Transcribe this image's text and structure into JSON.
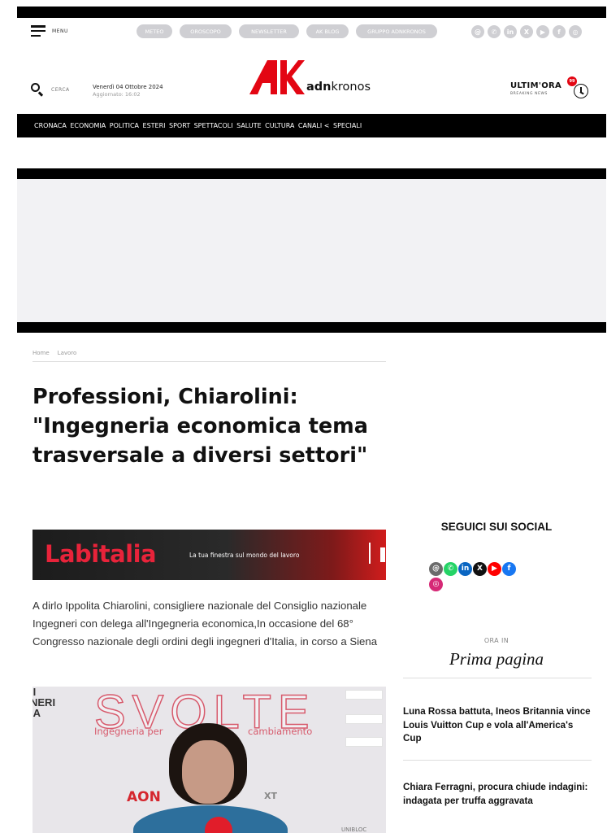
{
  "header": {
    "menu_label": "MENU",
    "search_label": "CERCA",
    "date": "Venerdì 04 Ottobre 2024",
    "updated": "Aggiornato: 16:02",
    "logo_text_bold": "adn",
    "logo_text_regular": "kronos",
    "breaking_title": "ULTIM'ORA",
    "breaking_sub": "BREAKING NEWS",
    "breaking_badge": "99",
    "brand_color": "#e30613"
  },
  "util_pills": [
    "METEO",
    "OROSCOPO",
    "NEWSLETTER",
    "AK BLOG",
    "GRUPPO ADNKRONOS"
  ],
  "top_social_icons": [
    "threads-icon",
    "whatsapp-icon",
    "linkedin-icon",
    "x-icon",
    "youtube-icon",
    "facebook-icon",
    "instagram-icon"
  ],
  "nav": [
    "CRONACA",
    "ECONOMIA",
    "POLITICA",
    "ESTERI",
    "SPORT",
    "SPETTACOLI",
    "SALUTE",
    "CULTURA",
    "CANALI <",
    "SPECIALI"
  ],
  "breadcrumb": [
    "Home",
    "Lavoro"
  ],
  "article": {
    "title": "Professioni, Chiarolini: \"Ingegneria economica tema trasversale a diversi settori\"",
    "lead": "A dirlo Ippolita Chiarolini, consigliere nazionale del Consiglio nazionale Ingegneri con delega all'Ingegneria economica,In occasione del 68° Congresso nazionale degli ordini degli ingegneri d'Italia, in corso a Siena"
  },
  "banner": {
    "brand": "Labitalia",
    "tagline": "La tua finestra sul mondo del lavoro"
  },
  "video": {
    "headline": "SVOLTE",
    "subtitle_left": "Ingegneria per",
    "subtitle_right": "cambiamento",
    "left_text": "II\nNERI\nIA",
    "sponsor": "AON",
    "sponsor_2": "XT",
    "corner_text": "UNIBLOC"
  },
  "sidebar": {
    "follow_title": "SEGUICI SUI SOCIAL",
    "social_icons": [
      {
        "name": "threads-icon",
        "glyph": "@",
        "color": "#6b6b6b"
      },
      {
        "name": "whatsapp-icon",
        "glyph": "✆",
        "color": "#25d366"
      },
      {
        "name": "linkedin-icon",
        "glyph": "in",
        "color": "#0a66c2"
      },
      {
        "name": "x-icon",
        "glyph": "X",
        "color": "#111111"
      },
      {
        "name": "youtube-icon",
        "glyph": "▶",
        "color": "#ff0000"
      },
      {
        "name": "facebook-icon",
        "glyph": "f",
        "color": "#1877f2"
      },
      {
        "name": "instagram-icon",
        "glyph": "◎",
        "color": "#d62976"
      }
    ],
    "front_kicker": "ORA IN",
    "front_title": "Prima pagina",
    "stories": [
      "Luna Rossa battuta, Ineos Britannia vince Louis Vuitton Cup e vola all'America's Cup",
      "Chiara Ferragni, procura chiude indagini: indagata per truffa aggravata"
    ]
  }
}
